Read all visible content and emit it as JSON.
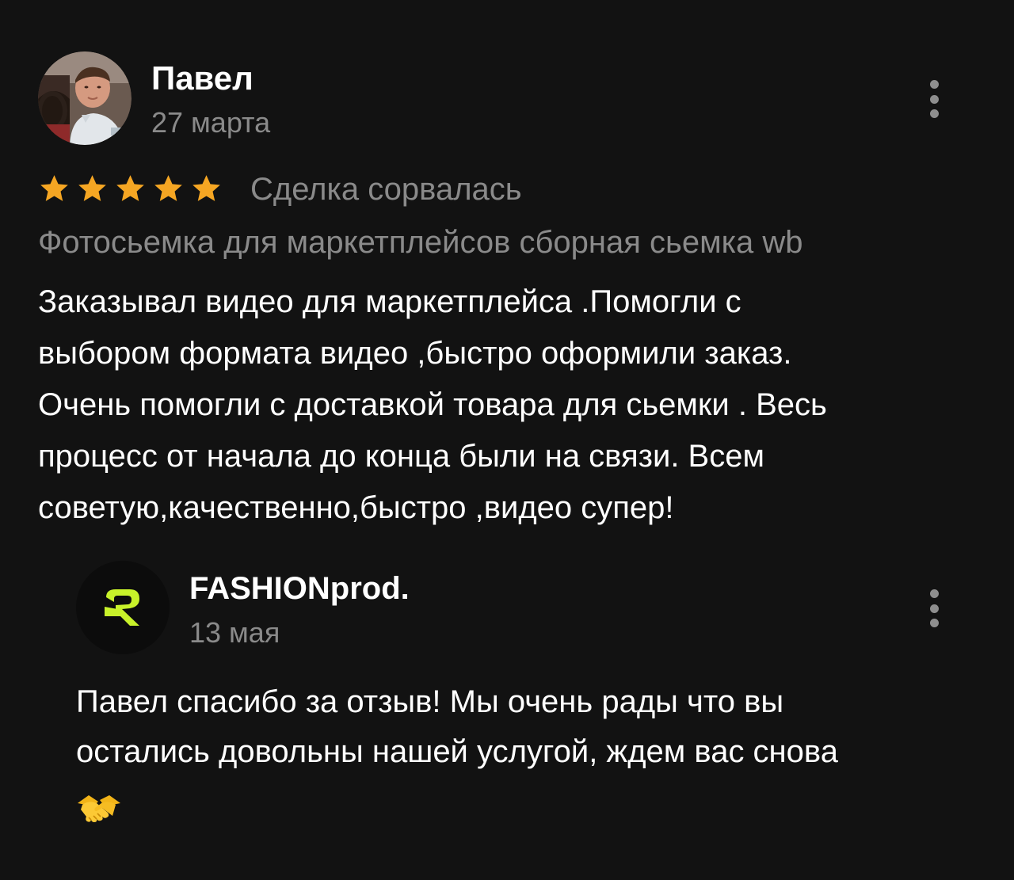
{
  "review": {
    "author_name": "Павел",
    "date": "27 марта",
    "rating": 5,
    "rating_max": 5,
    "deal_status": "Сделка сорвалась",
    "service": "Фотосьемка для маркетплейсов сборная сьемка wb",
    "text": "Заказывал видео для маркетплейса .Помогли с\nвыбором формата видео ,быстро оформили заказ.\nОчень помогли с доставкой товара для сьемки . Весь\nпроцесс от начала до конца были на связи. Всем\nсоветую,качественно,быстро ,видео супер!"
  },
  "reply": {
    "author_name": "FASHIONprod.",
    "date": "13 мая",
    "text": "Павел спасибо за отзыв! Мы очень рады что вы\nостались довольны нашей услугой, ждем вас снова",
    "emoji_icon": "handshake-icon"
  },
  "icons": {
    "star": "star-icon",
    "more": "more-vertical-icon",
    "logo": "fashionprod-logo-icon"
  },
  "colors": {
    "background": "#121212",
    "star": "#f5a623",
    "muted_text": "#8a8a8a",
    "logo_accent": "#c8f22a"
  }
}
